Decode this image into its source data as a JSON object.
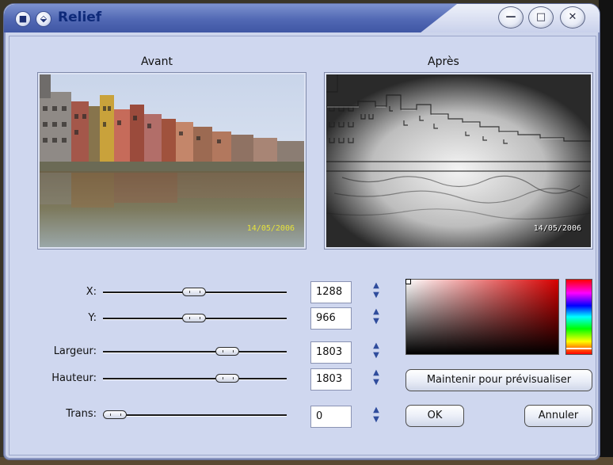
{
  "window": {
    "title": "Relief",
    "title_button_1": "■",
    "title_button_2": "⬙",
    "min_glyph": "—",
    "max_glyph": "□",
    "close_glyph": "✕"
  },
  "previews": {
    "before_label": "Avant",
    "after_label": "Après",
    "date_stamp": "14/05/2006"
  },
  "sliders": [
    {
      "label": "X:",
      "value": "1288",
      "level": 0.5
    },
    {
      "label": "Y:",
      "value": "966",
      "level": 0.5
    },
    {
      "label": "Largeur:",
      "value": "1803",
      "level": 0.66
    },
    {
      "label": "Hauteur:",
      "value": "1803",
      "level": 0.66
    },
    {
      "label": "Trans:",
      "value": "0",
      "level": 0.0
    }
  ],
  "icons": {
    "spin_up": "▲",
    "spin_down": "▼"
  },
  "color_picker": {
    "selected_hue": "#d80000"
  },
  "buttons": {
    "preview": "Maintenir pour prévisualiser",
    "ok": "OK",
    "cancel": "Annuler"
  }
}
